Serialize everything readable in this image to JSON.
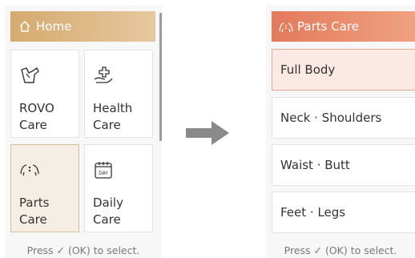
{
  "left_screen": {
    "header": "Home",
    "tiles": [
      {
        "label": "ROVO\nCare"
      },
      {
        "label": "Health\nCare"
      },
      {
        "label": "Parts\nCare"
      },
      {
        "label": "Daily\nCare",
        "icon_text": "DAY"
      }
    ],
    "hint": "Press ✓ (OK) to select."
  },
  "right_screen": {
    "header": "Parts Care",
    "items": [
      {
        "label": "Full Body"
      },
      {
        "label": "Neck · Shoulders"
      },
      {
        "label": "Waist · Butt"
      },
      {
        "label": "Feet · Legs"
      }
    ],
    "hint": "Press ✓ (OK) to select."
  },
  "colors": {
    "home_header": "#d4aa70",
    "parts_header": "#e27a5c",
    "arrow": "#8a8a8a"
  },
  "icons": [
    "home-icon",
    "rovo-care-icon",
    "health-care-icon",
    "parts-care-icon",
    "daily-care-icon",
    "parts-header-icon",
    "arrow-right-icon"
  ]
}
